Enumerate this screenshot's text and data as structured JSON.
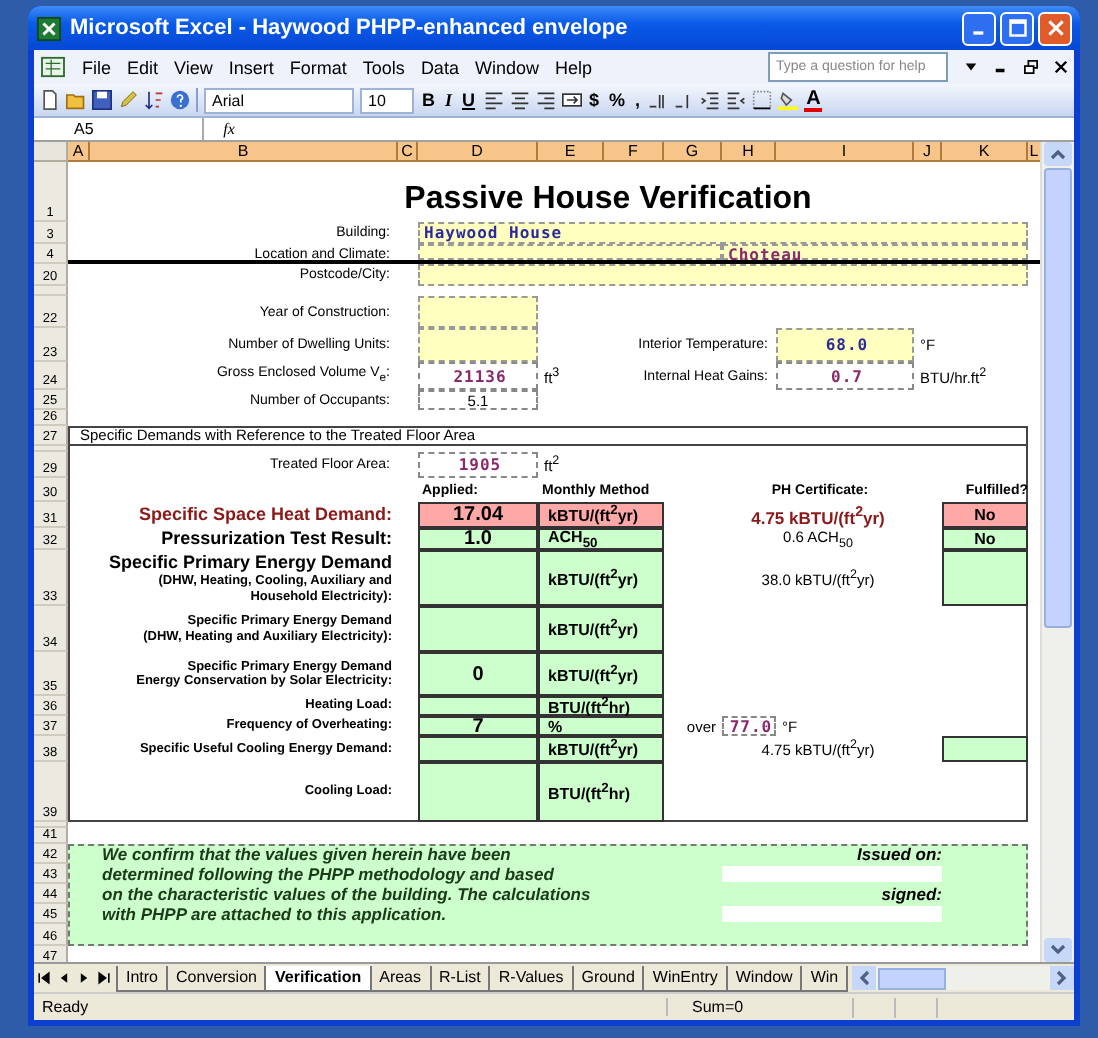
{
  "window": {
    "title": "Microsoft Excel - Haywood PHPP-enhanced envelope"
  },
  "menu": [
    "File",
    "Edit",
    "View",
    "Insert",
    "Format",
    "Tools",
    "Data",
    "Window",
    "Help"
  ],
  "help_search": {
    "placeholder": "Type a question for help"
  },
  "toolbar": {
    "font": "Arial",
    "font_size": "10",
    "format_buttons": [
      "B",
      "I",
      "U"
    ],
    "number_buttons": [
      "$",
      "%",
      ","
    ],
    "font_color_label": "A"
  },
  "formula_bar": {
    "name_box": "A5",
    "function_label": "fx"
  },
  "columns": [
    "A",
    "B",
    "C",
    "D",
    "E",
    "F",
    "G",
    "H",
    "I",
    "J",
    "K",
    "L"
  ],
  "row_numbers": [
    "1",
    "3",
    "4",
    "20",
    "22",
    "23",
    "24",
    "25",
    "26",
    "27",
    "29",
    "30",
    "31",
    "32",
    "33",
    "34",
    "35",
    "36",
    "37",
    "38",
    "39",
    "41",
    "42",
    "43",
    "44",
    "45",
    "46",
    "47"
  ],
  "sheet": {
    "title": "Passive House Verification",
    "building": {
      "label": "Building:",
      "value": "Haywood House"
    },
    "location": {
      "label": "Location and Climate:",
      "climate": "Choteau"
    },
    "postcode": {
      "label": "Postcode/City:"
    },
    "year": {
      "label": "Year of Construction:"
    },
    "dwelling_units": {
      "label": "Number of Dwelling Units:"
    },
    "volume": {
      "label": "Gross Enclosed Volume V$_{e}$:",
      "value": "21136",
      "unit": "ft$^{3}$"
    },
    "occupants": {
      "label": "Number of Occupants:",
      "value": "5.1"
    },
    "interior_temperature": {
      "label": "Interior Temperature:",
      "value": "68.0",
      "unit": "°F"
    },
    "internal_heat_gains": {
      "label": "Internal Heat Gains:",
      "value": "0.7",
      "unit": "BTU/hr.ft$^{2}$"
    },
    "demands": {
      "heading": "Specific Demands with Reference to the Treated Floor Area",
      "floor_area": {
        "label": "Treated Floor Area:",
        "value": "1905",
        "unit": "ft$^{2}$"
      },
      "columns": [
        "Applied:",
        "Monthly Method",
        "PH Certificate:",
        "Fulfilled?"
      ],
      "rows": [
        {
          "kind": "standard",
          "label": "Specific Space Heat Demand:",
          "highlighted": true,
          "value": "17.04",
          "unit": "kBTU/(ft$^{2}$yr)",
          "certificate": "4.75 kBTU/(ft$^{2}$yr)",
          "verdict_box": true,
          "verdict": "No"
        },
        {
          "kind": "standard",
          "label": "Pressurization Test Result:",
          "highlighted": false,
          "value": "1.0",
          "unit": "ACH$_{50}$",
          "certificate": "0.6 ACH$_{50}$",
          "verdict_box": true,
          "verdict": "No"
        },
        {
          "kind": "standard",
          "label": "Specific Primary Energy Demand",
          "note": "(DHW, Heating, Cooling, Auxiliary and Household Electricity):",
          "highlighted": false,
          "unit": "kBTU/(ft$^{2}$yr)",
          "certificate": "38.0 kBTU/(ft$^{2}$yr)",
          "verdict_box": true
        },
        {
          "kind": "standard",
          "label": "Specific Primary Energy Demand",
          "note": "(DHW, Heating and Auxiliary Electricity):",
          "highlighted": false,
          "unit": "kBTU/(ft$^{2}$yr)",
          "verdict_box": false
        },
        {
          "kind": "standard",
          "label": "Specific Primary Energy Demand",
          "note": "Energy Conservation by Solar Electricity:",
          "highlighted": false,
          "value": "0",
          "unit": "kBTU/(ft$^{2}$yr)",
          "verdict_box": false
        },
        {
          "kind": "standard",
          "label": "Heating Load:",
          "highlighted": false,
          "unit": "BTU/(ft$^{2}$hr)",
          "verdict_box": false
        },
        {
          "kind": "threshold",
          "label": "Frequency of Overheating:",
          "highlighted": false,
          "value": "7",
          "unit": "%",
          "threshold_label": "over",
          "threshold": "77.0",
          "threshold_unit": "°F",
          "verdict_box": false
        },
        {
          "kind": "standard",
          "label": "Specific Useful Cooling Energy Demand:",
          "highlighted": false,
          "unit": "kBTU/(ft$^{2}$yr)",
          "certificate": "4.75 kBTU/(ft$^{2}$yr)",
          "verdict_box": true
        },
        {
          "kind": "standard",
          "label": "Cooling Load:",
          "highlighted": false,
          "unit": "BTU/(ft$^{2}$hr)",
          "verdict_box": false
        }
      ]
    },
    "confirmation": {
      "lines": [
        "We confirm that the values given herein have been",
        "determined following the PHPP methodology and based",
        "on the characteristic values of the building. The calculations",
        " with PHPP are attached to this application."
      ],
      "issued_label": "Issued on:",
      "signed_label": "signed:"
    }
  },
  "sheet_tabs": [
    {
      "label": "Intro",
      "selected": false
    },
    {
      "label": "Conversion",
      "selected": false
    },
    {
      "label": "Verification",
      "selected": true
    },
    {
      "label": "Areas",
      "selected": false
    },
    {
      "label": "R-List",
      "selected": false
    },
    {
      "label": "R-Values",
      "selected": false
    },
    {
      "label": "Ground",
      "selected": false
    },
    {
      "label": "WinEntry",
      "selected": false
    },
    {
      "label": "Window",
      "selected": false
    },
    {
      "label": "Win",
      "selected": false
    }
  ],
  "status_bar": {
    "message": "Ready",
    "sum": "Sum=0"
  }
}
